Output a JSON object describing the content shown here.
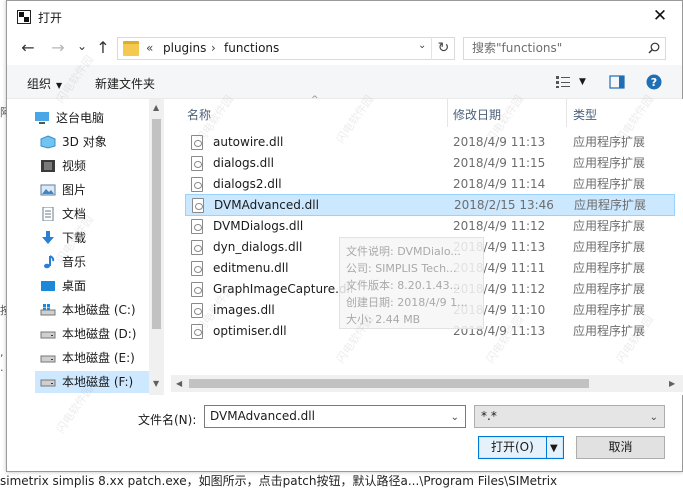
{
  "background": {
    "bottom_text": "simetrix simplis 8.xx patch.exe，如图所示，点击patch按钮，默认路径a...\\Program Files\\SIMetrix",
    "left_fragments": [
      "阿",
      "按",
      ",",
      "."
    ]
  },
  "dialog": {
    "title": "打开",
    "close_glyph": "✕"
  },
  "nav": {
    "back": "←",
    "forward": "→",
    "recent": "⌄",
    "up": "↑"
  },
  "address": {
    "overflow": "«",
    "crumbs": [
      "plugins",
      "functions"
    ],
    "separator": "›",
    "refresh_glyph": "↻"
  },
  "search": {
    "placeholder": "搜索\"functions\""
  },
  "toolbar": {
    "organize": "组织",
    "new_folder": "新建文件夹",
    "caret": "▼"
  },
  "sidebar": {
    "items": [
      {
        "label": "这台电脑",
        "icon": "computer-icon"
      },
      {
        "label": "3D 对象",
        "icon": "3d-objects-icon"
      },
      {
        "label": "视频",
        "icon": "videos-icon"
      },
      {
        "label": "图片",
        "icon": "pictures-icon"
      },
      {
        "label": "文档",
        "icon": "documents-icon"
      },
      {
        "label": "下载",
        "icon": "downloads-icon"
      },
      {
        "label": "音乐",
        "icon": "music-icon"
      },
      {
        "label": "桌面",
        "icon": "desktop-icon"
      },
      {
        "label": "本地磁盘 (C:)",
        "icon": "windows-drive-icon"
      },
      {
        "label": "本地磁盘 (D:)",
        "icon": "drive-icon"
      },
      {
        "label": "本地磁盘 (E:)",
        "icon": "drive-icon"
      },
      {
        "label": "本地磁盘 (F:)",
        "icon": "drive-icon"
      }
    ]
  },
  "columns": {
    "name": "名称",
    "date": "修改日期",
    "type": "类型"
  },
  "files": [
    {
      "name": "autowire.dll",
      "date": "2018/4/9 11:13",
      "type": "应用程序扩展"
    },
    {
      "name": "dialogs.dll",
      "date": "2018/4/9 11:15",
      "type": "应用程序扩展"
    },
    {
      "name": "dialogs2.dll",
      "date": "2018/4/9 11:14",
      "type": "应用程序扩展"
    },
    {
      "name": "DVMAdvanced.dll",
      "date": "2018/2/15 13:46",
      "type": "应用程序扩展"
    },
    {
      "name": "DVMDialogs.dll",
      "date": "2018/4/9 11:12",
      "type": "应用程序扩展"
    },
    {
      "name": "dyn_dialogs.dll",
      "date": "2018/4/9 11:13",
      "type": "应用程序扩展"
    },
    {
      "name": "editmenu.dll",
      "date": "2018/4/9 11:11",
      "type": "应用程序扩展"
    },
    {
      "name": "GraphImageCapture.dll",
      "date": "2018/4/9 11:12",
      "type": "应用程序扩展"
    },
    {
      "name": "images.dll",
      "date": "2018/4/9 11:10",
      "type": "应用程序扩展"
    },
    {
      "name": "optimiser.dll",
      "date": "2018/4/9 11:13",
      "type": "应用程序扩展"
    }
  ],
  "selected_file": "DVMAdvanced.dll",
  "tooltip": {
    "lines": [
      "文件说明: DVMDialo...",
      "公司: SIMPLIS Tech...",
      "文件版本: 8.20.1.43...",
      "创建日期: 2018/4/9 1...",
      "大小: 2.44 MB"
    ]
  },
  "filename": {
    "label": "文件名(N):",
    "value": "DVMAdvanced.dll"
  },
  "filter": {
    "value": "*.*"
  },
  "buttons": {
    "open": "打开(O)",
    "cancel": "取消"
  },
  "watermark_text": "闪电软件园",
  "colors": {
    "selection": "#cce8ff",
    "selection_border": "#99d1ff",
    "accent": "#0078d7",
    "header_text": "#4c607a"
  }
}
